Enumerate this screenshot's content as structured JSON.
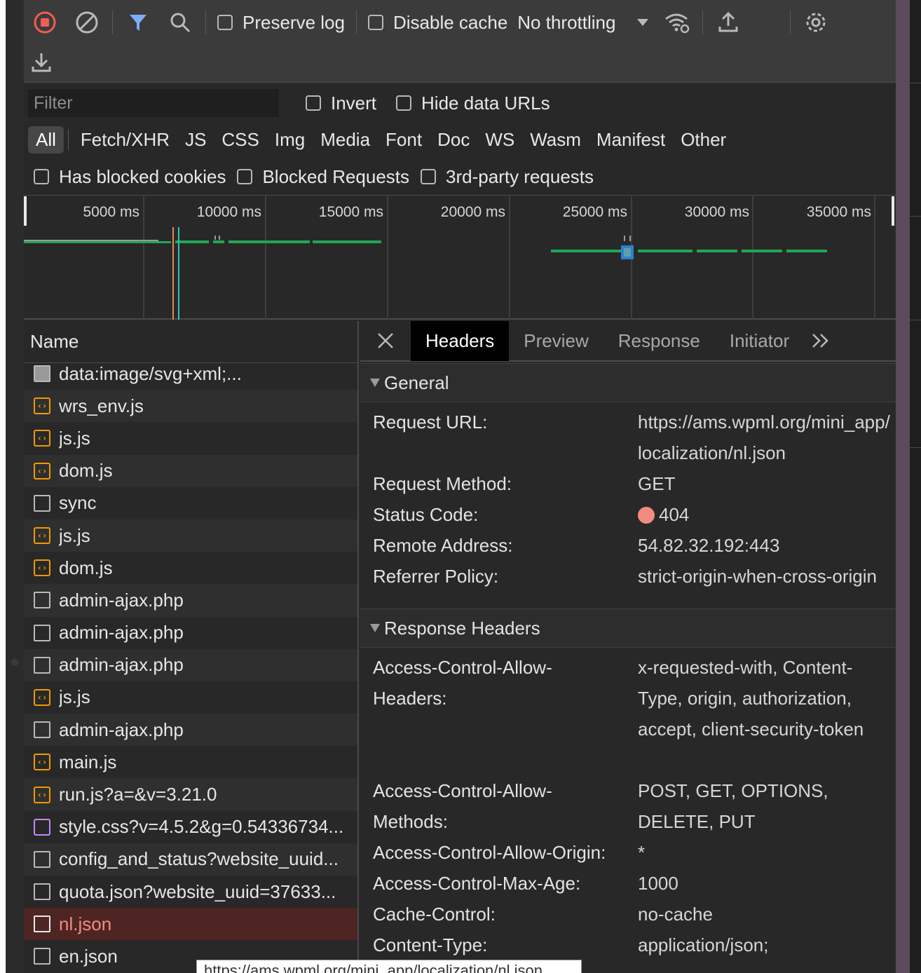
{
  "toolbar": {
    "preserve_log": "Preserve log",
    "disable_cache": "Disable cache",
    "throttling": "No throttling"
  },
  "filter": {
    "placeholder": "Filter",
    "invert": "Invert",
    "hide_data_urls": "Hide data URLs",
    "types": [
      "All",
      "Fetch/XHR",
      "JS",
      "CSS",
      "Img",
      "Media",
      "Font",
      "Doc",
      "WS",
      "Wasm",
      "Manifest",
      "Other"
    ],
    "has_blocked_cookies": "Has blocked cookies",
    "blocked_requests": "Blocked Requests",
    "third_party": "3rd-party requests"
  },
  "timeline": {
    "ticks": [
      "5000 ms",
      "10000 ms",
      "15000 ms",
      "20000 ms",
      "25000 ms",
      "30000 ms",
      "35000 ms"
    ]
  },
  "requests": {
    "header": "Name",
    "rows": [
      {
        "name": "data:image/svg+xml;...",
        "icon": "img"
      },
      {
        "name": "wrs_env.js",
        "icon": "script"
      },
      {
        "name": "js.js",
        "icon": "script"
      },
      {
        "name": "dom.js",
        "icon": "script"
      },
      {
        "name": "sync",
        "icon": "doc"
      },
      {
        "name": "js.js",
        "icon": "script"
      },
      {
        "name": "dom.js",
        "icon": "script"
      },
      {
        "name": "admin-ajax.php",
        "icon": "doc"
      },
      {
        "name": "admin-ajax.php",
        "icon": "doc"
      },
      {
        "name": "admin-ajax.php",
        "icon": "doc"
      },
      {
        "name": "js.js",
        "icon": "script"
      },
      {
        "name": "admin-ajax.php",
        "icon": "doc"
      },
      {
        "name": "main.js",
        "icon": "script"
      },
      {
        "name": "run.js?a=&v=3.21.0",
        "icon": "script"
      },
      {
        "name": "style.css?v=4.5.2&g=0.54336734...",
        "icon": "css"
      },
      {
        "name": "config_and_status?website_uuid...",
        "icon": "doc"
      },
      {
        "name": "quota.json?website_uuid=37633...",
        "icon": "doc"
      },
      {
        "name": "nl.json",
        "icon": "doc",
        "selected": true
      },
      {
        "name": "en.json",
        "icon": "doc"
      }
    ]
  },
  "details": {
    "tabs": [
      "Headers",
      "Preview",
      "Response",
      "Initiator"
    ],
    "general": {
      "title": "General",
      "request_url_label": "Request URL:",
      "request_url": "https://ams.wpml.org/mini_app/localization/nl.json",
      "request_method_label": "Request Method:",
      "request_method": "GET",
      "status_code_label": "Status Code:",
      "status_code": "404",
      "remote_address_label": "Remote Address:",
      "remote_address": "54.82.32.192:443",
      "referrer_policy_label": "Referrer Policy:",
      "referrer_policy": "strict-origin-when-cross-origin"
    },
    "response_headers": {
      "title": "Response Headers",
      "acah_label": "Access-Control-Allow-Headers:",
      "acah": "x-requested-with, Content-Type, origin, authorization, accept, client-security-token",
      "acam_label": "Access-Control-Allow-Methods:",
      "acam": "POST, GET, OPTIONS, DELETE, PUT",
      "acao_label": "Access-Control-Allow-Origin:",
      "acao": "*",
      "acma_label": "Access-Control-Max-Age:",
      "acma": "1000",
      "cache_control_label": "Cache-Control:",
      "cache_control": "no-cache",
      "content_type_label": "Content-Type:",
      "content_type": "application/json;"
    }
  },
  "tooltip": "https://ams.wpml.org/mini_app/localization/nl.json",
  "colors": {
    "record": "#f25c54",
    "filter_active": "#7cacf8",
    "error_text": "#f28b82",
    "selected_row": "#4e2523",
    "waterfall_green": "#1fa755",
    "dom_content_loaded": "#e38b4a",
    "load": "#2bc4c4"
  }
}
